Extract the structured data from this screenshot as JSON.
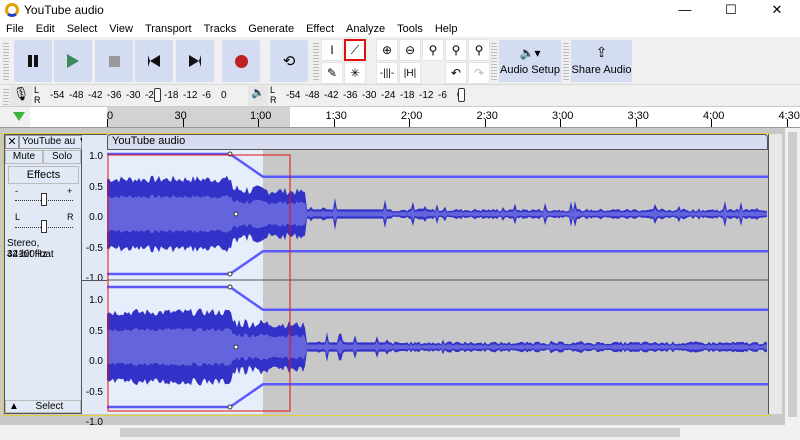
{
  "window": {
    "title": "YouTube audio",
    "controls": [
      "—",
      "☐",
      "✕"
    ]
  },
  "menu": [
    "File",
    "Edit",
    "Select",
    "View",
    "Transport",
    "Tracks",
    "Generate",
    "Effect",
    "Analyze",
    "Tools",
    "Help"
  ],
  "toolbar": {
    "audio_setup": "Audio Setup",
    "share_audio": "Share Audio",
    "active_tool": "envelope-tool"
  },
  "meters": {
    "rec_lr": [
      "L",
      "R"
    ],
    "play_lr": [
      "L",
      "R"
    ],
    "rec_scale": [
      "-54",
      "-48",
      "-42",
      "-36",
      "-30",
      "-24",
      "-18",
      "-12",
      "-6",
      "0"
    ],
    "play_scale": [
      "-54",
      "-48",
      "-42",
      "-36",
      "-30",
      "-24",
      "-18",
      "-12",
      "-6",
      "0"
    ]
  },
  "timeline": {
    "labels": [
      "0",
      "30",
      "1:00",
      "1:30",
      "2:00",
      "2:30",
      "3:00",
      "3:30",
      "4:00",
      "4:30"
    ]
  },
  "track": {
    "name": "YouTube au",
    "clip_name": "YouTube audio",
    "mute": "Mute",
    "solo": "Solo",
    "effects": "Effects",
    "gain_labels": [
      "-",
      "+"
    ],
    "pan_labels": [
      "L",
      "R"
    ],
    "info1": "Stereo, 44100Hz",
    "info2": "32-bit float",
    "select": "Select",
    "close": "✕",
    "vruler": [
      "1.0",
      "0.5",
      "0.0",
      "-0.5",
      "-1.0"
    ]
  },
  "colors": {
    "wave": "#3232c8",
    "wave_light": "#6464dc",
    "envelope": "#5a5aff",
    "selection": "#e6edfb",
    "bg": "#c8c8c8",
    "highlight": "#e01010"
  }
}
